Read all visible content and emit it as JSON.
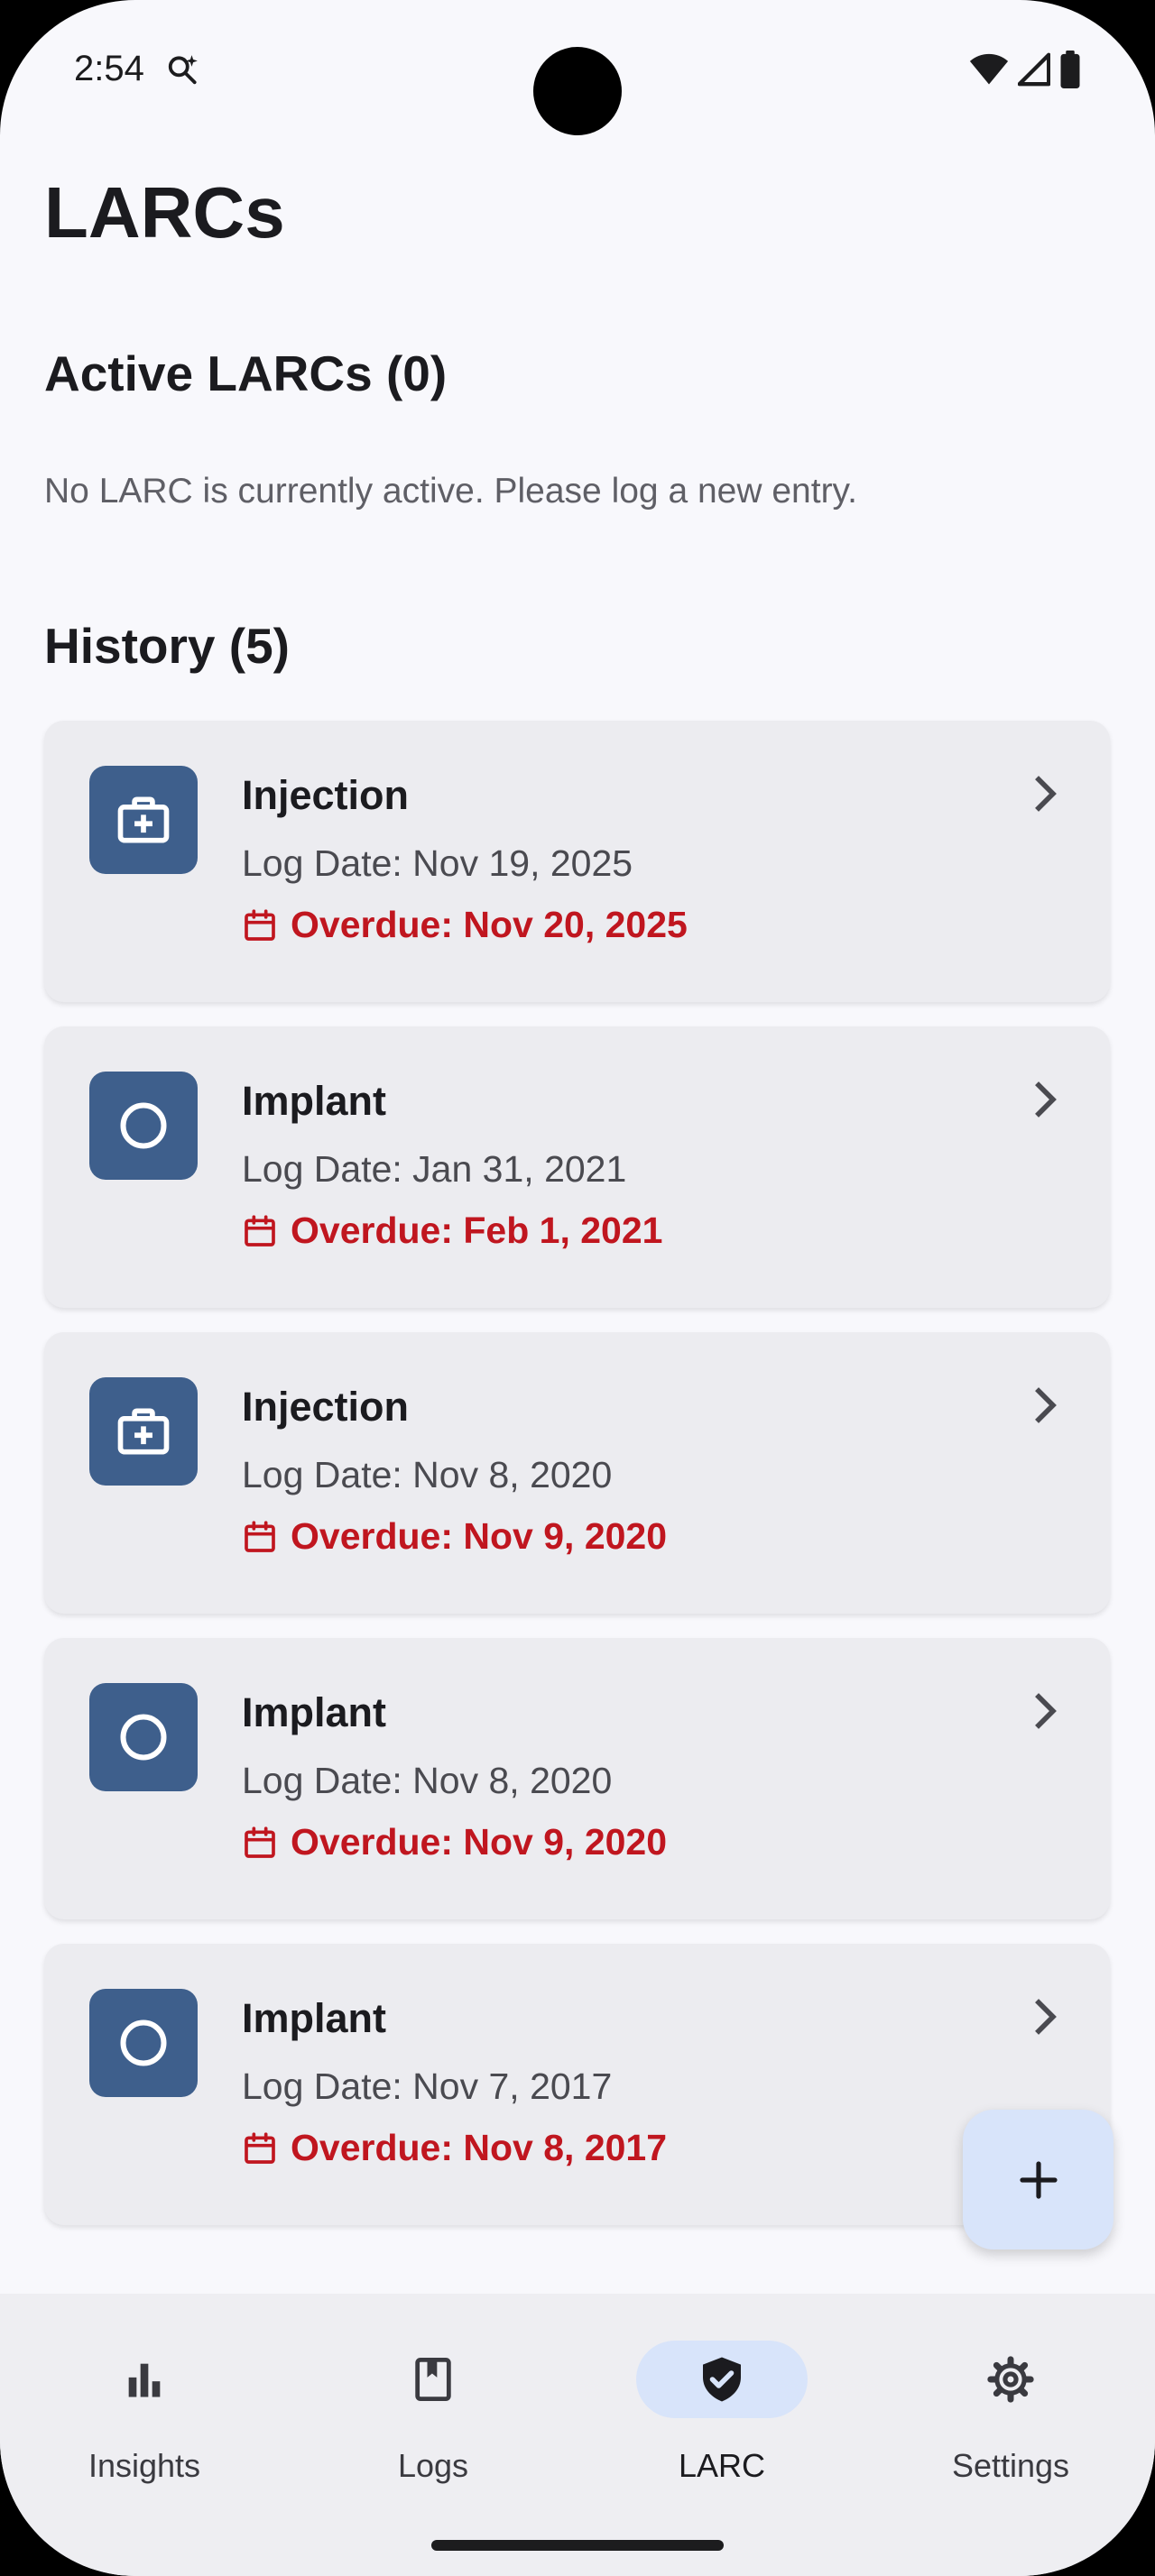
{
  "status_bar": {
    "time": "2:54"
  },
  "page": {
    "title": "LARCs"
  },
  "active": {
    "heading": "Active LARCs (0)",
    "empty_message": "No LARC is currently active. Please log a new entry."
  },
  "history": {
    "heading": "History (5)",
    "items": [
      {
        "type": "Injection",
        "icon": "medical-kit-icon",
        "log_date": "Log Date: Nov 19, 2025",
        "overdue": "Overdue: Nov 20, 2025"
      },
      {
        "type": "Implant",
        "icon": "circle-icon",
        "log_date": "Log Date: Jan 31, 2021",
        "overdue": "Overdue: Feb 1, 2021"
      },
      {
        "type": "Injection",
        "icon": "medical-kit-icon",
        "log_date": "Log Date: Nov 8, 2020",
        "overdue": "Overdue: Nov 9, 2020"
      },
      {
        "type": "Implant",
        "icon": "circle-icon",
        "log_date": "Log Date: Nov 8, 2020",
        "overdue": "Overdue: Nov 9, 2020"
      },
      {
        "type": "Implant",
        "icon": "circle-icon",
        "log_date": "Log Date: Nov 7, 2017",
        "overdue": "Overdue: Nov 8, 2017"
      }
    ]
  },
  "fab": {
    "icon": "plus-icon"
  },
  "nav": {
    "items": [
      {
        "label": "Insights",
        "icon": "bar-chart-icon",
        "active": false
      },
      {
        "label": "Logs",
        "icon": "bookmark-book-icon",
        "active": false
      },
      {
        "label": "LARC",
        "icon": "shield-check-icon",
        "active": true
      },
      {
        "label": "Settings",
        "icon": "gear-icon",
        "active": false
      }
    ]
  },
  "colors": {
    "accent": "#3e5f8c",
    "overdue": "#c0161f",
    "card_bg": "#ececf0",
    "active_pill": "#d8e4fa",
    "background": "#f8f8fc"
  }
}
